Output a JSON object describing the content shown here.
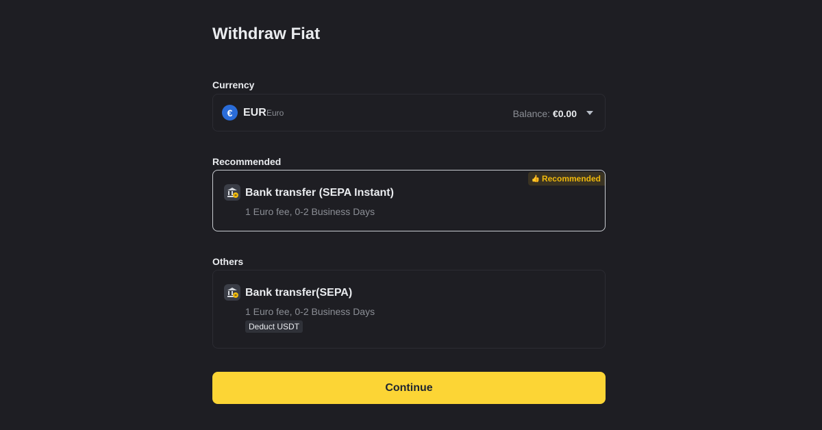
{
  "page": {
    "title": "Withdraw Fiat"
  },
  "currency": {
    "label": "Currency",
    "code": "EUR",
    "name": "Euro",
    "symbol": "€",
    "balance_label": "Balance:",
    "balance_value": "€0.00"
  },
  "recommended": {
    "label": "Recommended",
    "method": {
      "title": "Bank transfer (SEPA Instant)",
      "description": "1 Euro fee, 0-2 Business Days",
      "badge": "Recommended"
    }
  },
  "others": {
    "label": "Others",
    "methods": [
      {
        "title": "Bank transfer(SEPA)",
        "description": "1 Euro fee, 0-2 Business Days",
        "tag": "Deduct USDT"
      }
    ]
  },
  "actions": {
    "continue_label": "Continue"
  },
  "icons": {
    "currency": "euro-coin-icon",
    "dropdown": "chevron-down-icon",
    "method": "bank-icon",
    "badge": "thumbs-up-icon"
  },
  "colors": {
    "background": "#1e1e23",
    "accent": "#fcd535",
    "badge_text": "#f0b90b",
    "euro_blue": "#2a6cd8"
  }
}
